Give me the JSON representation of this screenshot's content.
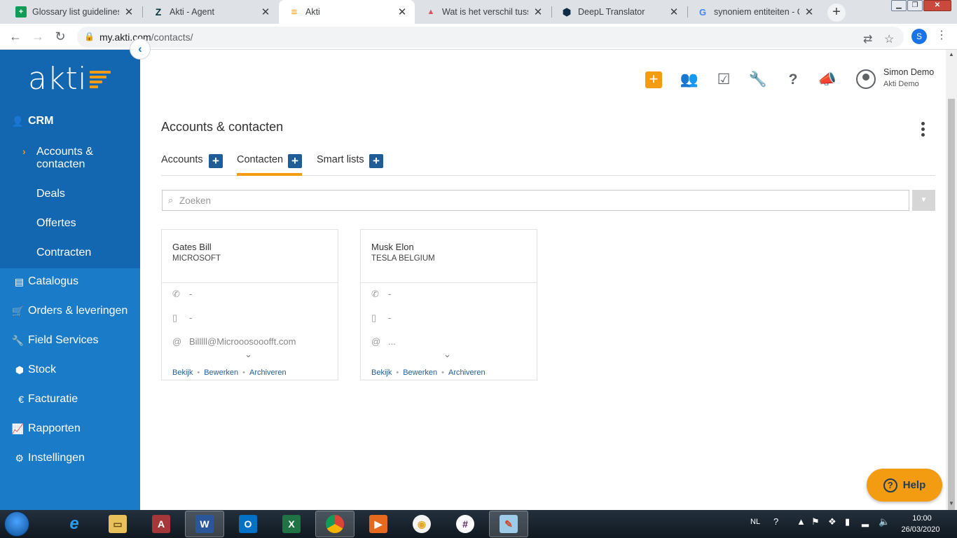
{
  "browser": {
    "tabs": [
      {
        "title": "Glossary list guidelines -",
        "favicon": "sheets-icon",
        "color": "#0f9d58",
        "glyph": "+"
      },
      {
        "title": "Akti - Agent",
        "favicon": "zendesk-icon",
        "color": "#03363d",
        "glyph": "Z"
      },
      {
        "title": "Akti",
        "favicon": "akti-icon",
        "color": "#f39c12",
        "glyph": "≡"
      },
      {
        "title": "Wat is het verschil tusse",
        "favicon": "triangle-icon",
        "color": "#e0515a",
        "glyph": "▲"
      },
      {
        "title": "DeepL Translator",
        "favicon": "deepl-icon",
        "color": "#0f2b46",
        "glyph": "⬢"
      },
      {
        "title": "synoniem entiteiten - Go",
        "favicon": "google-icon",
        "color": "#4285f4",
        "glyph": "G"
      }
    ],
    "tab_close": "✕",
    "new_tab": "+",
    "url_host": "my.akti.com",
    "url_path": "/contacts/",
    "profile_initial": "S"
  },
  "sidebar": {
    "logo": "akti",
    "collapse": "‹",
    "crm_label": "CRM",
    "sub_items": [
      {
        "label": "Accounts &",
        "label2": "contacten",
        "active": true
      },
      {
        "label": "Deals"
      },
      {
        "label": "Offertes"
      },
      {
        "label": "Contracten"
      }
    ],
    "items": [
      {
        "label": "Catalogus",
        "icon": "book-icon",
        "glyph": "▤"
      },
      {
        "label": "Orders & leveringen",
        "icon": "cart-icon",
        "glyph": "🛒"
      },
      {
        "label": "Field Services",
        "icon": "wrench-icon",
        "glyph": "🔧"
      },
      {
        "label": "Stock",
        "icon": "cubes-icon",
        "glyph": "⬢"
      },
      {
        "label": "Facturatie",
        "icon": "euro-icon",
        "glyph": "€"
      },
      {
        "label": "Rapporten",
        "icon": "chart-icon",
        "glyph": "📈"
      },
      {
        "label": "Instellingen",
        "icon": "gear-icon",
        "glyph": "⚙"
      }
    ]
  },
  "header": {
    "add": "+",
    "user_name": "Simon Demo",
    "user_company": "Akti Demo"
  },
  "main": {
    "title": "Accounts & contacten",
    "tabs": [
      {
        "label": "Accounts"
      },
      {
        "label": "Contacten",
        "active": true
      },
      {
        "label": "Smart lists"
      }
    ],
    "plus": "+",
    "search_placeholder": "Zoeken",
    "cards": [
      {
        "name": "Gates Bill",
        "company": "MICROSOFT",
        "phone": "-",
        "mobile": "-",
        "email": "Billlll@Microoosooofft.com"
      },
      {
        "name": "Musk Elon",
        "company": "TESLA BELGIUM",
        "phone": "-",
        "mobile": "-",
        "email": "..."
      }
    ],
    "actions": {
      "view": "Bekijk",
      "edit": "Bewerken",
      "archive": "Archiveren"
    },
    "help": "Help"
  },
  "taskbar": {
    "lang": "NL",
    "time": "10:00",
    "date": "26/03/2020"
  }
}
